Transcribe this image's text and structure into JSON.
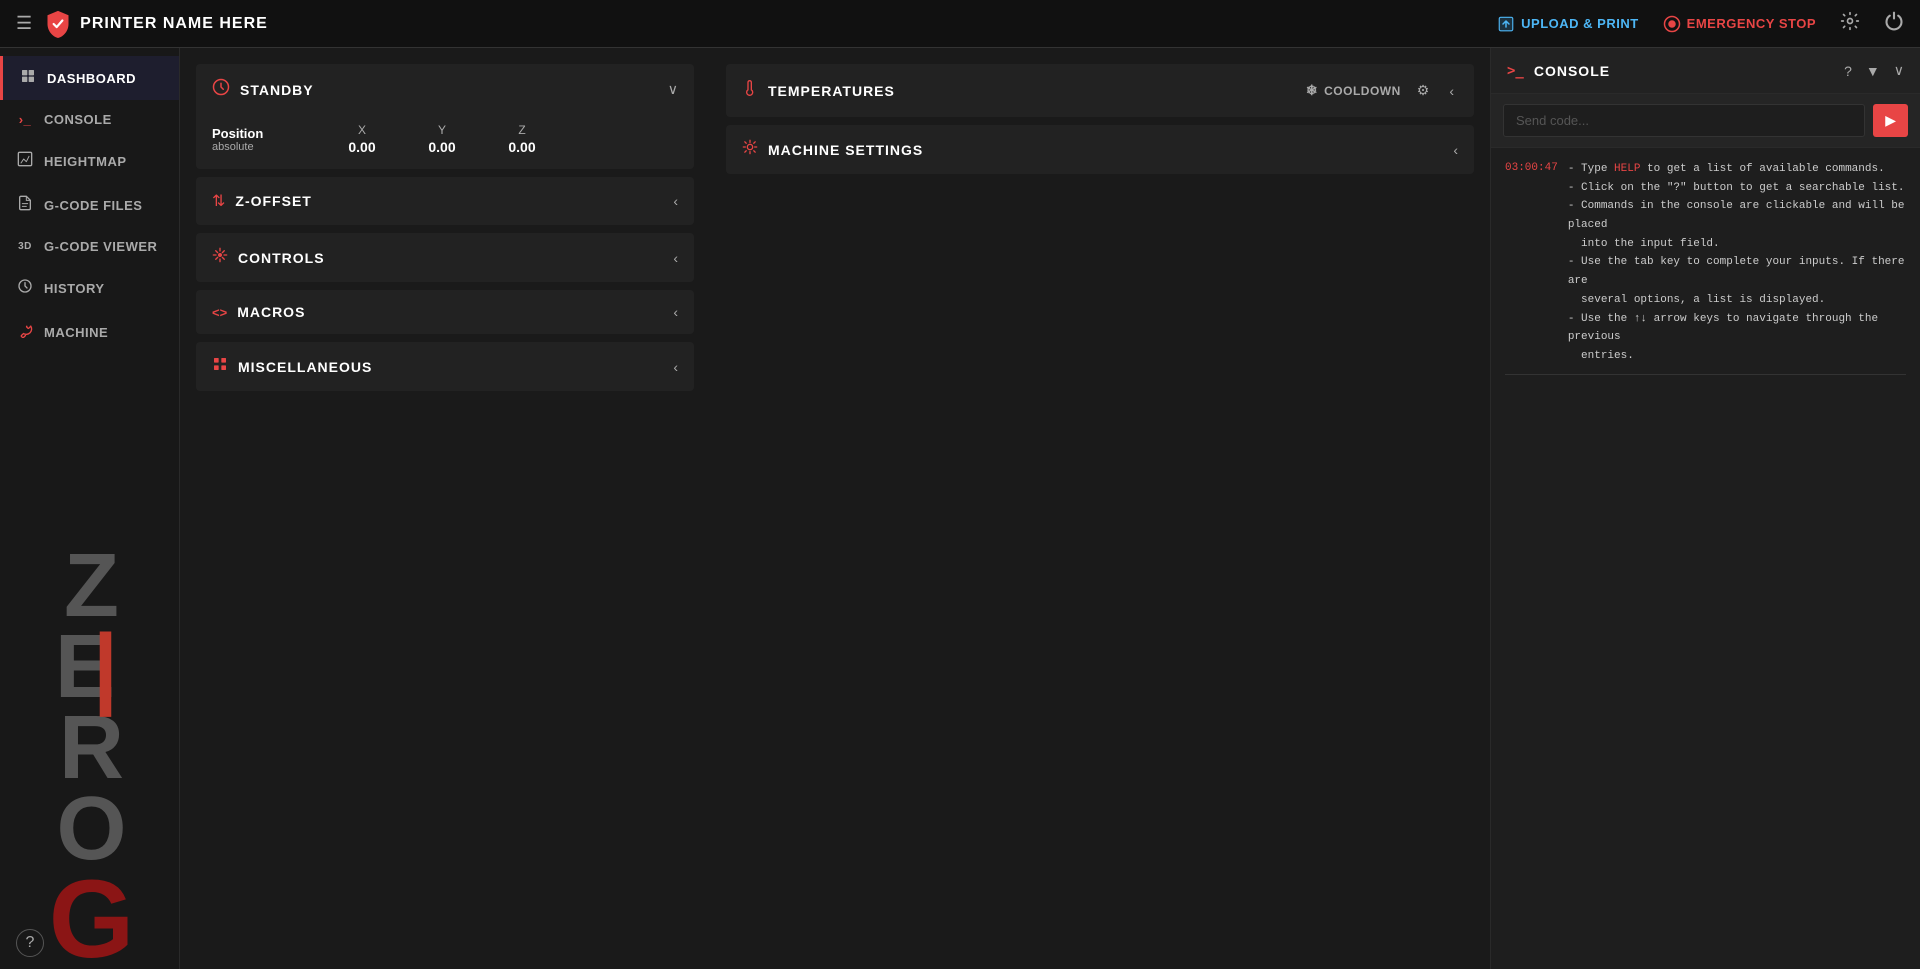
{
  "topbar": {
    "menu_icon": "☰",
    "brand_name": "PRINTER NAME HERE",
    "upload_label": "UPLOAD & PRINT",
    "emergency_label": "EMERGENCY STOP",
    "settings_icon": "⚙",
    "power_icon": "⏻"
  },
  "sidebar": {
    "items": [
      {
        "id": "dashboard",
        "label": "DASHBOARD",
        "icon": "⊞",
        "active": true
      },
      {
        "id": "console",
        "label": "CONSOLE",
        "icon": "›_"
      },
      {
        "id": "heightmap",
        "label": "HEIGHTMAP",
        "icon": "▦"
      },
      {
        "id": "gcode-files",
        "label": "G-CODE FILES",
        "icon": "📄"
      },
      {
        "id": "gcode-viewer",
        "label": "G-CODE VIEWER",
        "icon": "3D"
      },
      {
        "id": "history",
        "label": "HISTORY",
        "icon": "⟳"
      },
      {
        "id": "machine",
        "label": "MACHINE",
        "icon": "🔧"
      }
    ],
    "help_label": "?"
  },
  "left_panel": {
    "standby": {
      "title": "STANDBY",
      "chevron": "∨",
      "position": {
        "label": "Position",
        "sublabel": "absolute",
        "x": {
          "axis": "X",
          "value": "0.00"
        },
        "y": {
          "axis": "Y",
          "value": "0.00"
        },
        "z": {
          "axis": "Z",
          "value": "0.00"
        }
      }
    },
    "sections": [
      {
        "id": "z-offset",
        "title": "Z-OFFSET",
        "icon": "⇅"
      },
      {
        "id": "controls",
        "title": "CONTROLS",
        "icon": "✦"
      },
      {
        "id": "macros",
        "title": "MACROS",
        "icon": "<>"
      },
      {
        "id": "miscellaneous",
        "title": "MISCELLANEOUS",
        "icon": "⊞"
      }
    ]
  },
  "middle_panel": {
    "temperatures": {
      "title": "TEMPERATURES",
      "cooldown_label": "COOLDOWN",
      "settings_icon": "⚙",
      "chevron": "‹"
    },
    "machine_settings": {
      "title": "MACHINE SETTINGS",
      "chevron": "‹"
    }
  },
  "console_panel": {
    "title": "CONSOLE",
    "title_icon": ">_",
    "help_btn": "?",
    "filter_btn": "▼",
    "collapse_btn": "∨",
    "input_placeholder": "Send code...",
    "send_icon": "▶",
    "log": [
      {
        "timestamp": "03:00:47",
        "lines": [
          "- Type HELP to get a list of available commands.",
          "- Click on the \"?\" button to get a searchable list.",
          "- Commands in the console are clickable and will be placed",
          "  into the input field.",
          "- Use the tab key to complete your inputs. If there are",
          "  several options, a list is displayed.",
          "- Use the ↑↓ arrow keys to navigate through the previous",
          "  entries."
        ]
      }
    ]
  },
  "colors": {
    "accent": "#e84545",
    "brand": "#e84545",
    "text_primary": "#ffffff",
    "text_secondary": "#aaaaaa",
    "bg_dark": "#111111",
    "bg_sidebar": "#181818",
    "bg_card": "#222222"
  }
}
